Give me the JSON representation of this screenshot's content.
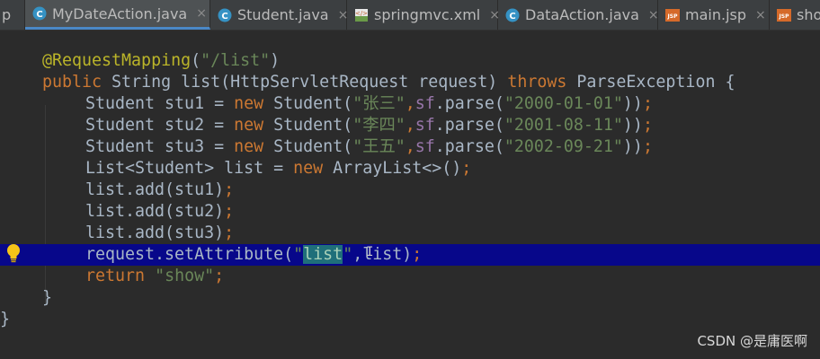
{
  "tabs": [
    {
      "label": "p",
      "icon": "java-class-icon",
      "active": false
    },
    {
      "label": "MyDateAction.java",
      "icon": "java-class-icon",
      "active": true
    },
    {
      "label": "Student.java",
      "icon": "java-class-icon",
      "active": false
    },
    {
      "label": "springmvc.xml",
      "icon": "xml-file-icon",
      "active": false
    },
    {
      "label": "DataAction.java",
      "icon": "java-class-icon",
      "active": false
    },
    {
      "label": "main.jsp",
      "icon": "jsp-file-icon",
      "active": false
    },
    {
      "label": "sho",
      "icon": "jsp-file-icon",
      "active": false
    }
  ],
  "tab_close_glyph": "×",
  "jsp_icon_text": "JSP",
  "code": {
    "l1": {
      "ann": "@RequestMapping",
      "p1": "(",
      "str": "\"/list\"",
      "p2": ")"
    },
    "l2": {
      "kw1": "public",
      "p1": " String list(HttpServletRequest request) ",
      "kw2": "throws",
      "p2": " ParseException {"
    },
    "l3": {
      "p1": "Student stu1 = ",
      "kw": "new",
      "p2": " Student(",
      "str1": "\"张三\"",
      "comma": ",",
      "field": "sf",
      "p3": ".parse(",
      "str2": "\"2000-01-01\"",
      "p4": "))",
      "semi": ";"
    },
    "l4": {
      "p1": "Student stu2 = ",
      "kw": "new",
      "p2": " Student(",
      "str1": "\"李四\"",
      "comma": ",",
      "field": "sf",
      "p3": ".parse(",
      "str2": "\"2001-08-11\"",
      "p4": "))",
      "semi": ";"
    },
    "l5": {
      "p1": "Student stu3 = ",
      "kw": "new",
      "p2": " Student(",
      "str1": "\"王五\"",
      "comma": ",",
      "field": "sf",
      "p3": ".parse(",
      "str2": "\"2002-09-21\"",
      "p4": "))",
      "semi": ";"
    },
    "l6": {
      "p1": "List<Student> list = ",
      "kw": "new",
      "p2": " ArrayList<>()",
      "semi": ";"
    },
    "l7": {
      "p1": "list.add(stu1)",
      "semi": ";"
    },
    "l8": {
      "p1": "list.add(stu2)",
      "semi": ";"
    },
    "l9": {
      "p1": "list.add(stu3)",
      "semi": ";"
    },
    "l10": {
      "p1": "request.setAttribute(",
      "q1": "\"",
      "sel": "list",
      "q2": "\"",
      "p2": ",list)",
      "semi": ";"
    },
    "l11": {
      "kw": "return",
      "sp": " ",
      "str": "\"show\"",
      "semi": ";"
    },
    "l12": {
      "p1": "}"
    },
    "l13": {
      "p1": "}"
    }
  },
  "watermark": "CSDN @是庸医啊",
  "colors": {
    "background": "#2b2b2b",
    "keyword": "#cc7832",
    "annotation": "#bbb529",
    "string": "#6a8759",
    "field": "#9876aa",
    "identifier": "#a9b7c6",
    "line_highlight": "#07078a",
    "active_tab_underline": "#4a88c7"
  }
}
